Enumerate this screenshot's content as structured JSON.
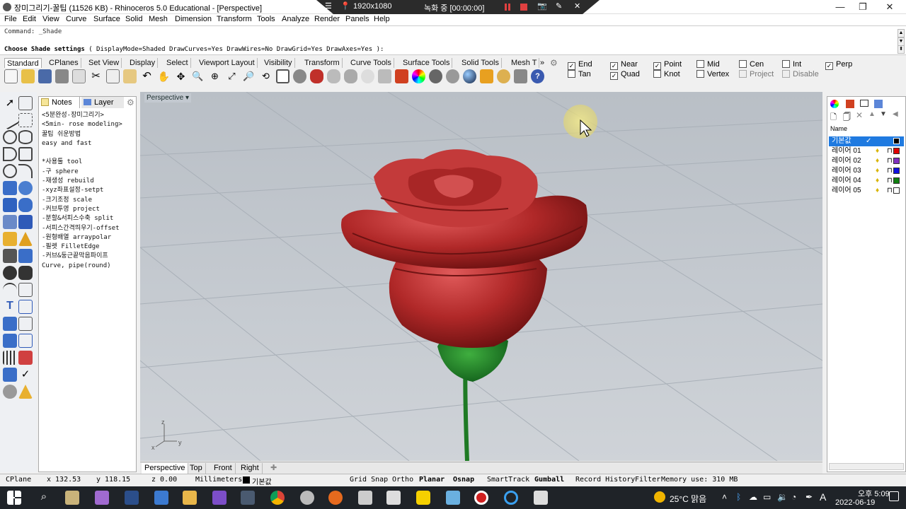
{
  "title_bar": {
    "title": "장미그리기-꿀팁 (11526 KB) - Rhinoceros 5.0 Educational - [Perspective]",
    "min": "—",
    "max": "❐",
    "close": "✕"
  },
  "recorder": {
    "resolution": "1920x1080",
    "status": "녹화 중 [00:00:00]"
  },
  "menu": [
    "File",
    "Edit",
    "View",
    "Curve",
    "Surface",
    "Solid",
    "Mesh",
    "Dimension",
    "Transform",
    "Tools",
    "Analyze",
    "Render",
    "Panels",
    "Help"
  ],
  "command": {
    "history": "Command: _Shade",
    "prompt_label": "Choose Shade settings",
    "prompt_options": "( DisplayMode=Shaded  DrawCurves=Yes  DrawWires=No  DrawGrid=Yes  DrawAxes=Yes ):"
  },
  "toolbar_tabs": [
    "Standard",
    "CPlanes",
    "Set View",
    "Display",
    "Select",
    "Viewport Layout",
    "Visibility",
    "Transform",
    "Curve Tools",
    "Surface Tools",
    "Solid Tools",
    "Mesh T"
  ],
  "toolbar_more": "»",
  "osnap": [
    {
      "label": "End",
      "checked": true
    },
    {
      "label": "Near",
      "checked": true
    },
    {
      "label": "Point",
      "checked": true
    },
    {
      "label": "Mid",
      "checked": false
    },
    {
      "label": "Cen",
      "checked": false
    },
    {
      "label": "Int",
      "checked": false
    },
    {
      "label": "Perp",
      "checked": true
    },
    {
      "label": "Tan",
      "checked": false
    },
    {
      "label": "Quad",
      "checked": true
    },
    {
      "label": "Knot",
      "checked": false
    },
    {
      "label": "Vertex",
      "checked": false
    },
    {
      "label": "Project",
      "checked": false
    },
    {
      "label": "Disable",
      "checked": false
    }
  ],
  "notes_panel": {
    "tab_notes": "Notes",
    "tab_layers": "Layer",
    "text": "<5분완성-장미그리기>\n<5min- rose modeling>\n꿀팁 쉬운방법\neasy and fast\n\n*사용툴 tool\n-구 sphere\n-재생성 rebuild\n-xyz좌표설정-setpt\n-크기조정 scale\n-커브투영 project\n-분할&서피스수축 split\n-서피스간격띄우기-offset\n-원형배열 arraypolar\n-필렛 FilletEdge\n-커브&둥근끝막음파이프\nCurve, pipe(round)"
  },
  "viewport": {
    "label": "Perspective",
    "tabs": [
      "Perspective",
      "Top",
      "Front",
      "Right"
    ],
    "axis_x": "x",
    "axis_y": "y",
    "axis_z": "z"
  },
  "layers_panel": {
    "column": "Name",
    "layers": [
      {
        "name": "기본값",
        "color": "#000000",
        "current": true
      },
      {
        "name": "레이어 01",
        "color": "#e00000",
        "current": false
      },
      {
        "name": "레이어 02",
        "color": "#8030c0",
        "current": false
      },
      {
        "name": "레이어 03",
        "color": "#1010e0",
        "current": false
      },
      {
        "name": "레이어 04",
        "color": "#108010",
        "current": false
      },
      {
        "name": "레이어 05",
        "color": "#ffffff",
        "current": false
      }
    ]
  },
  "status": {
    "cplane": "CPlane",
    "x": "x 132.53",
    "y": "y 118.15",
    "z": "z 0.00",
    "units": "Millimeters",
    "layer": "기본값",
    "grid_snap": "Grid Snap",
    "ortho": "Ortho",
    "planar": "Planar",
    "osnap": "Osnap",
    "smarttrack": "SmartTrack",
    "gumball": "Gumball",
    "record_history": "Record History",
    "filter": "Filter",
    "memory": "Memory use: 310 MB"
  },
  "taskbar": {
    "weather": "25°C 맑음",
    "ime": "A",
    "time": "오후 5:09",
    "date": "2022-06-19"
  }
}
